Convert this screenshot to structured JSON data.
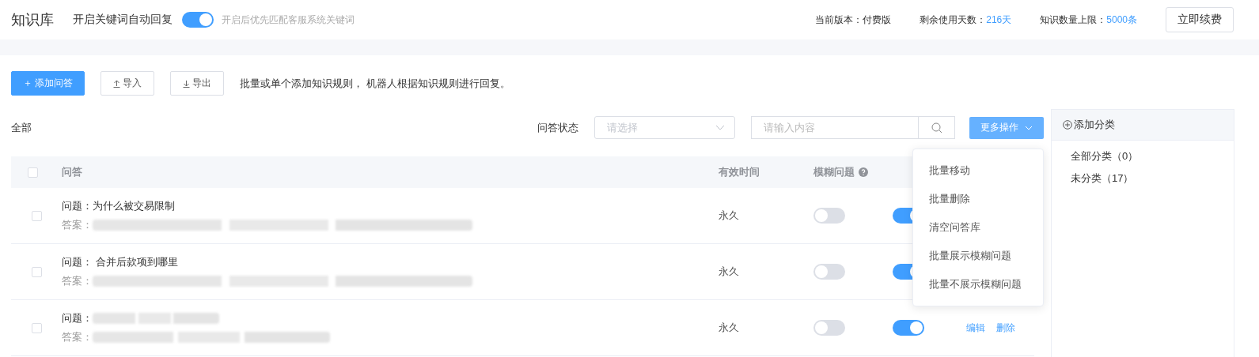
{
  "header": {
    "title": "知识库",
    "auto_reply_label": "开启关键词自动回复",
    "auto_reply_on": true,
    "hint": "开启后优先匹配客服系统关键词",
    "stats": [
      {
        "label": "当前版本：",
        "value": "付费版",
        "kind": "plain"
      },
      {
        "label": "剩余使用天数：",
        "value": "216天",
        "kind": "accent"
      },
      {
        "label": "知识数量上限：",
        "value": "5000条",
        "kind": "accent"
      }
    ],
    "renew_button": "立即续费"
  },
  "toolbar": {
    "add_button": "＋ 添加问答",
    "import_button": "导入",
    "export_button": "导出",
    "description": "批量或单个添加知识规则， 机器人根据知识规则进行回复。"
  },
  "filter": {
    "scope": "全部",
    "status_label": "问答状态",
    "status_placeholder": "请选择",
    "search_placeholder": "请输入内容",
    "more_button": "更多操作"
  },
  "more_menu": {
    "expanded": true,
    "items": [
      "批量移动",
      "批量删除",
      "清空问答库",
      "批量展示模糊问题",
      "批量不展示模糊问题"
    ]
  },
  "table": {
    "select_all_checked": false,
    "columns": [
      "问答",
      "有效时间",
      "模糊问题"
    ],
    "rows": [
      {
        "checked": false,
        "question_label": "问题：",
        "question": "为什么被交易限制",
        "answer_label": "答案：",
        "validity": "永久",
        "fuzzy": false,
        "enabled": true
      },
      {
        "checked": false,
        "question_label": "问题：",
        "question": " 合并后款项到哪里",
        "answer_label": "答案：",
        "validity": "永久",
        "fuzzy": false,
        "enabled": true
      },
      {
        "checked": false,
        "question_label": "问题：",
        "answer_label": "答案：",
        "validity": "永久",
        "fuzzy": false,
        "enabled": true,
        "actions": [
          "编辑",
          "删除"
        ]
      }
    ]
  },
  "categories": {
    "add_button": "添加分类",
    "items": [
      {
        "label": "全部分类（0）"
      },
      {
        "label": "未分类（17）"
      }
    ]
  }
}
